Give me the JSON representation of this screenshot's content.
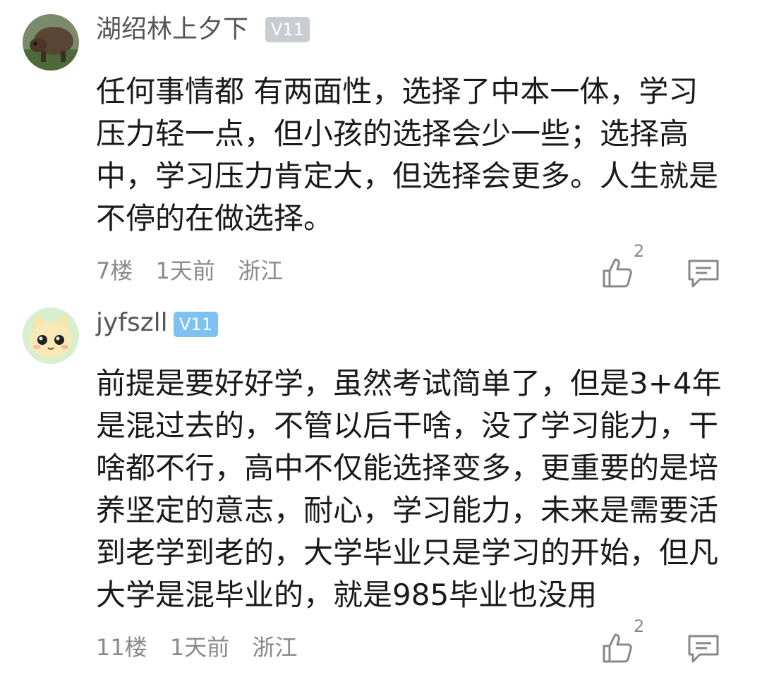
{
  "comments": [
    {
      "username": "湖绍林上夕下",
      "level": "V11",
      "level_color": "#c9cdd2",
      "lines": [
        "任何事情都 有两面性，选择了中本一体，学习",
        "压力轻一点，但小孩的选择会少一些；选择高",
        "中，学习压力肯定大，但选择会更多。人生就是",
        "不停的在做选择。"
      ],
      "floor": "7楼",
      "time": "1天前",
      "location": "浙江",
      "likes": "2",
      "avatar_icon": "bear-avatar-icon"
    },
    {
      "username": "jyfszll",
      "level": "V11",
      "level_color": "#7ec1f2",
      "lines": [
        "前提是要好好学，虽然考试简单了，但是3+4年",
        "是混过去的，不管以后干啥，没了学习能力，干",
        "啥都不行，高中不仅能选择变多，更重要的是培",
        "养坚定的意志，耐心，学习能力，未来是需要活",
        "到老学到老的，大学毕业只是学习的开始，但凡",
        "大学是混毕业的，就是985毕业也没用"
      ],
      "floor": "11楼",
      "time": "1天前",
      "location": "浙江",
      "likes": "2",
      "avatar_icon": "cat-avatar-icon"
    }
  ],
  "icons": {
    "like": "thumbs-up-icon",
    "reply": "comment-bubble-icon"
  }
}
